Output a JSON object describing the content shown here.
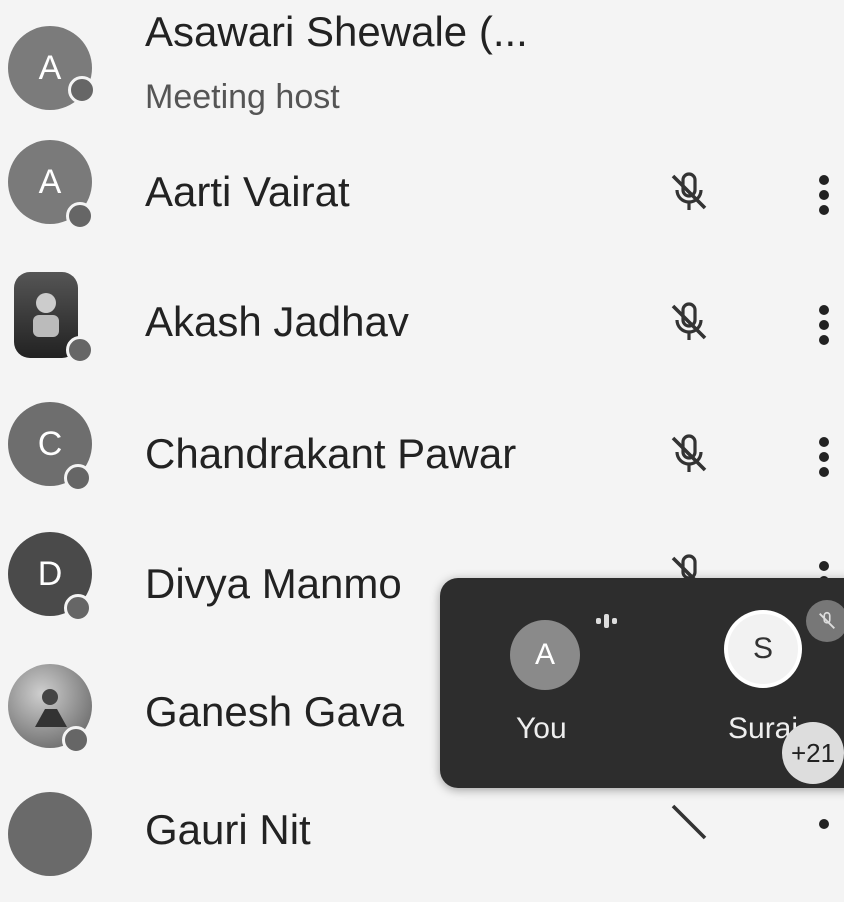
{
  "participants": [
    {
      "initial": "A",
      "name": "Asawari Shewale (...",
      "role": "Meeting host",
      "avatar_color": "#7b7b7b"
    },
    {
      "initial": "A",
      "name": "Aarti Vairat",
      "avatar_color": "#7a7a7a"
    },
    {
      "initial": "",
      "name": "Akash Jadhav",
      "avatar_color": "#3a3a3a"
    },
    {
      "initial": "C",
      "name": "Chandrakant Pawar",
      "avatar_color": "#6e6e6e"
    },
    {
      "initial": "D",
      "name": "Divya Manmo",
      "avatar_color": "#4a4a4a"
    },
    {
      "initial": "",
      "name": "Ganesh Gava",
      "avatar_color": "#8a8a8a"
    },
    {
      "initial": "",
      "name": "Gauri Nit",
      "avatar_color": "#6a6a6a"
    }
  ],
  "overlay": {
    "tiles": [
      {
        "label": "You",
        "initial": "A",
        "avatar_color": "#8a8a8a"
      },
      {
        "label": "Suraj",
        "initial": "S",
        "avatar_color": "#f2f2f2"
      }
    ],
    "more_count": "+21"
  },
  "icons": {
    "mic_off": "mic-off-icon",
    "more": "more-vert-icon",
    "speaking": "speaking-indicator-icon"
  }
}
